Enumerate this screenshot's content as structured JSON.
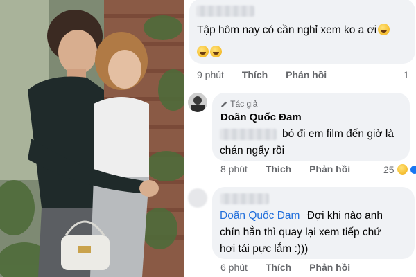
{
  "comments": [
    {
      "text_line1": "Tập hôm nay có cần nghỉ xem ko a ơi",
      "time": "9 phút",
      "like_label": "Thích",
      "reply_label": "Phản hồi",
      "reaction_count": "1"
    },
    {
      "author_badge": "Tác giả",
      "author_name": "Doãn Quốc Đam",
      "text_line1": "bỏ đi em film đến giờ là",
      "text_line2": "chán ngấy rồi",
      "time": "8 phút",
      "like_label": "Thích",
      "reply_label": "Phản hồi",
      "reaction_count": "25"
    },
    {
      "tagged_name": "Doãn Quốc Đam",
      "text_line1": "Đợi khi nào anh",
      "text_line2": "chín hẳn thì quay lại xem tiếp chứ",
      "text_line3": "hơi tái pực lắm :)))",
      "time": "6 phút",
      "like_label": "Thích",
      "reply_label": "Phản hồi"
    }
  ],
  "icons": {
    "emoji": "laughing-face-icon",
    "author_badge_icon": "pencil-icon",
    "reaction": "haha-reaction-icon"
  },
  "colors": {
    "bubble_bg": "#f0f2f5",
    "meta_text": "#65676b",
    "tag_link": "#216fdb",
    "like_blue": "#1877f2"
  }
}
